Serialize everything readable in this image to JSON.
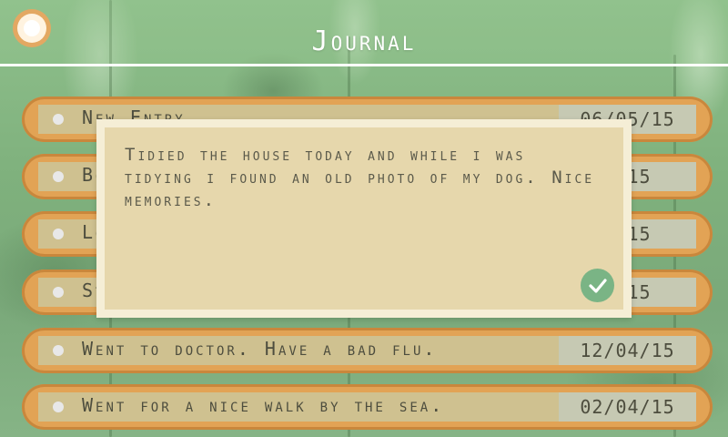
{
  "header": {
    "title": "Journal",
    "back_icon": "circle-back-icon"
  },
  "entries": [
    {
      "text": "New Entry",
      "date": "06/05/15"
    },
    {
      "text": "Bo",
      "date": "5/15"
    },
    {
      "text": "Lo",
      "date": "4/15"
    },
    {
      "text": "St",
      "date": "4/15"
    },
    {
      "text": "Went to doctor. Have a bad flu.",
      "date": "12/04/15"
    },
    {
      "text": "Went for a nice walk by the sea.",
      "date": "02/04/15"
    }
  ],
  "dialog": {
    "text": "Tidied the house today and while i was tidying i found an old photo of my dog. Nice memories.",
    "confirm_icon": "checkmark-icon"
  },
  "colors": {
    "entry_frame": "#e2a355",
    "dialog_bg": "#e6d7ac",
    "confirm": "#7ab485",
    "header_line": "#ffffff"
  }
}
